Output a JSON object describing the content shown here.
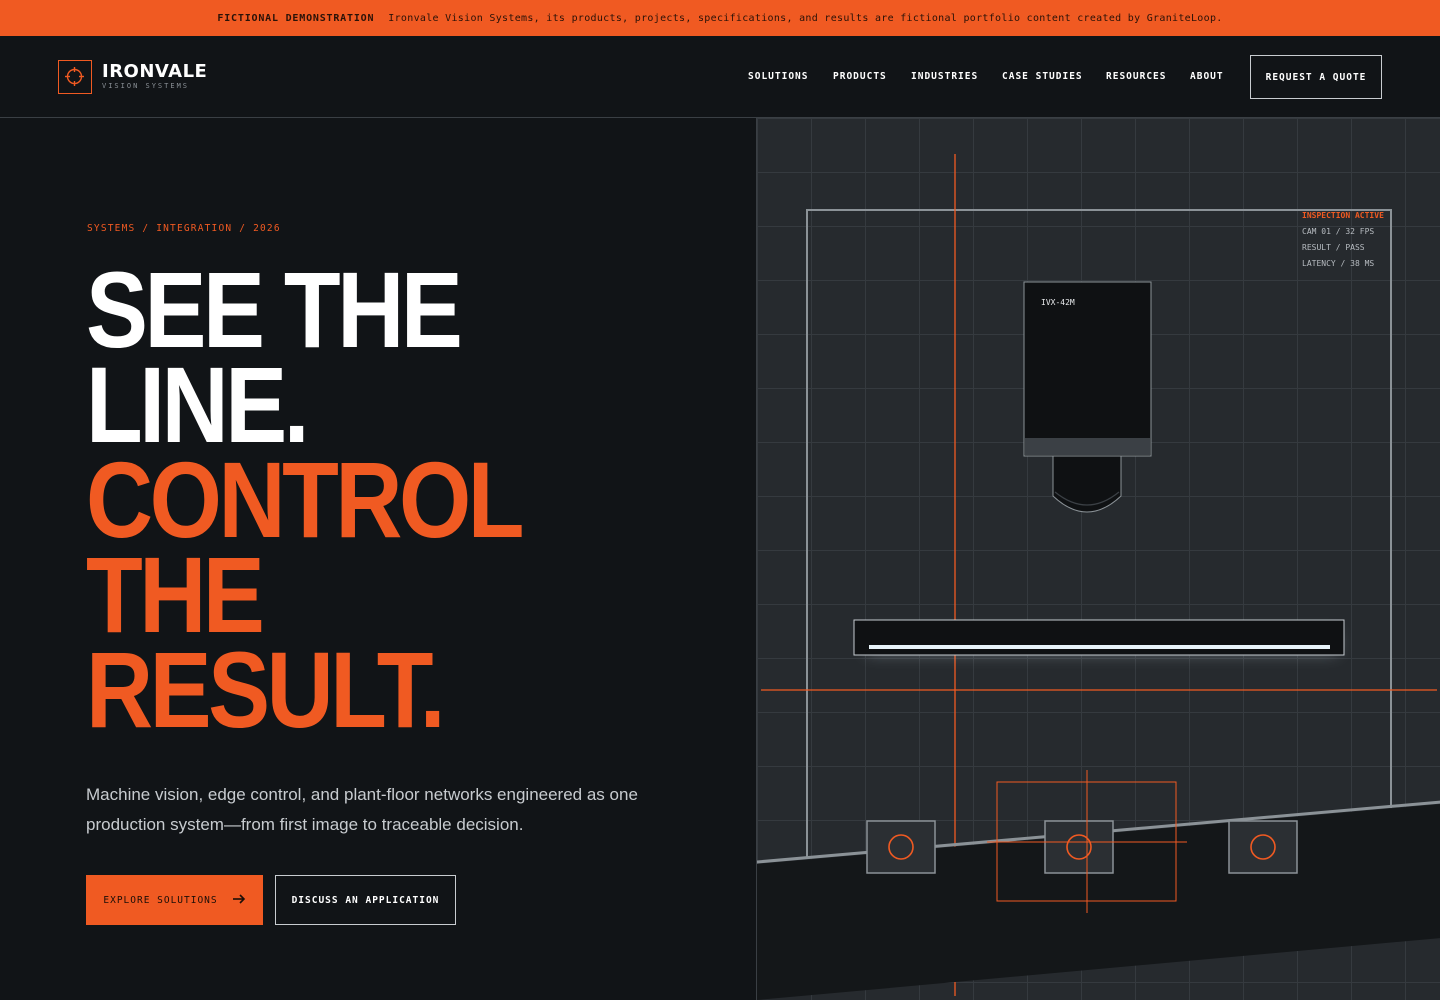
{
  "banner": {
    "title": "FICTIONAL DEMONSTRATION",
    "text": "Ironvale Vision Systems, its products, projects, specifications, and results are fictional portfolio content created by GraniteLoop."
  },
  "header": {
    "logo": {
      "name": "IRONVALE",
      "subtitle": "VISION SYSTEMS",
      "icon": "crosshair-icon"
    },
    "nav": [
      "SOLUTIONS",
      "PRODUCTS",
      "INDUSTRIES",
      "CASE STUDIES",
      "RESOURCES",
      "ABOUT"
    ],
    "cta": "REQUEST A QUOTE"
  },
  "hero": {
    "eyebrow": "SYSTEMS / INTEGRATION / 2026",
    "headline_white": [
      "SEE THE",
      "LINE."
    ],
    "headline_orange": [
      "CONTROL",
      "THE",
      "RESULT."
    ],
    "lead": "Machine vision, edge control, and plant-floor networks engineered as one production system—from first image to traceable decision.",
    "primary_button": "EXPLORE SOLUTIONS",
    "primary_icon": "arrow-right-icon",
    "secondary_button": "DISCUSS AN APPLICATION"
  },
  "visual": {
    "camera_model": "IVX-42M",
    "status": [
      "INSPECTION ACTIVE",
      "CAM 01 / 32 FPS",
      "RESULT / PASS",
      "LATENCY / 38 MS"
    ]
  },
  "colors": {
    "accent": "#f05a22",
    "background": "#111417",
    "panel": "#262a2e",
    "text": "#ffffff"
  }
}
